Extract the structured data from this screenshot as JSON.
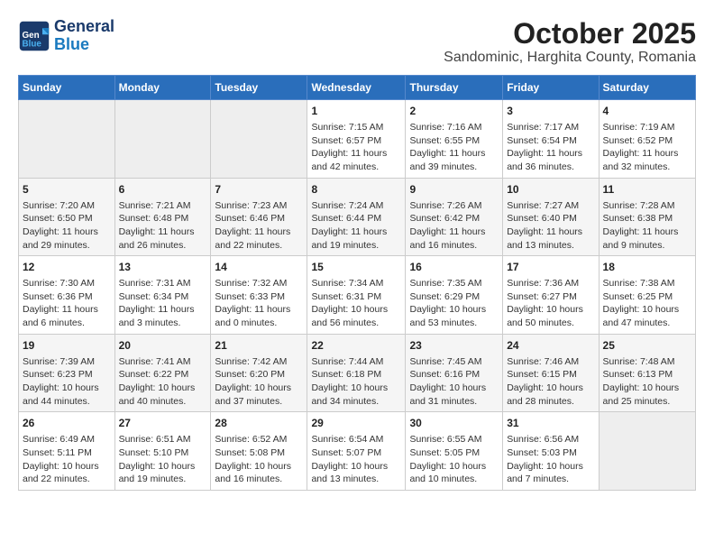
{
  "logo": {
    "line1": "General",
    "line2": "Blue"
  },
  "title": "October 2025",
  "subtitle": "Sandominic, Harghita County, Romania",
  "weekdays": [
    "Sunday",
    "Monday",
    "Tuesday",
    "Wednesday",
    "Thursday",
    "Friday",
    "Saturday"
  ],
  "weeks": [
    [
      {
        "day": "",
        "empty": true
      },
      {
        "day": "",
        "empty": true
      },
      {
        "day": "",
        "empty": true
      },
      {
        "day": "1",
        "sunrise": "7:15 AM",
        "sunset": "6:57 PM",
        "daylight": "11 hours and 42 minutes."
      },
      {
        "day": "2",
        "sunrise": "7:16 AM",
        "sunset": "6:55 PM",
        "daylight": "11 hours and 39 minutes."
      },
      {
        "day": "3",
        "sunrise": "7:17 AM",
        "sunset": "6:54 PM",
        "daylight": "11 hours and 36 minutes."
      },
      {
        "day": "4",
        "sunrise": "7:19 AM",
        "sunset": "6:52 PM",
        "daylight": "11 hours and 32 minutes."
      }
    ],
    [
      {
        "day": "5",
        "sunrise": "7:20 AM",
        "sunset": "6:50 PM",
        "daylight": "11 hours and 29 minutes."
      },
      {
        "day": "6",
        "sunrise": "7:21 AM",
        "sunset": "6:48 PM",
        "daylight": "11 hours and 26 minutes."
      },
      {
        "day": "7",
        "sunrise": "7:23 AM",
        "sunset": "6:46 PM",
        "daylight": "11 hours and 22 minutes."
      },
      {
        "day": "8",
        "sunrise": "7:24 AM",
        "sunset": "6:44 PM",
        "daylight": "11 hours and 19 minutes."
      },
      {
        "day": "9",
        "sunrise": "7:26 AM",
        "sunset": "6:42 PM",
        "daylight": "11 hours and 16 minutes."
      },
      {
        "day": "10",
        "sunrise": "7:27 AM",
        "sunset": "6:40 PM",
        "daylight": "11 hours and 13 minutes."
      },
      {
        "day": "11",
        "sunrise": "7:28 AM",
        "sunset": "6:38 PM",
        "daylight": "11 hours and 9 minutes."
      }
    ],
    [
      {
        "day": "12",
        "sunrise": "7:30 AM",
        "sunset": "6:36 PM",
        "daylight": "11 hours and 6 minutes."
      },
      {
        "day": "13",
        "sunrise": "7:31 AM",
        "sunset": "6:34 PM",
        "daylight": "11 hours and 3 minutes."
      },
      {
        "day": "14",
        "sunrise": "7:32 AM",
        "sunset": "6:33 PM",
        "daylight": "11 hours and 0 minutes."
      },
      {
        "day": "15",
        "sunrise": "7:34 AM",
        "sunset": "6:31 PM",
        "daylight": "10 hours and 56 minutes."
      },
      {
        "day": "16",
        "sunrise": "7:35 AM",
        "sunset": "6:29 PM",
        "daylight": "10 hours and 53 minutes."
      },
      {
        "day": "17",
        "sunrise": "7:36 AM",
        "sunset": "6:27 PM",
        "daylight": "10 hours and 50 minutes."
      },
      {
        "day": "18",
        "sunrise": "7:38 AM",
        "sunset": "6:25 PM",
        "daylight": "10 hours and 47 minutes."
      }
    ],
    [
      {
        "day": "19",
        "sunrise": "7:39 AM",
        "sunset": "6:23 PM",
        "daylight": "10 hours and 44 minutes."
      },
      {
        "day": "20",
        "sunrise": "7:41 AM",
        "sunset": "6:22 PM",
        "daylight": "10 hours and 40 minutes."
      },
      {
        "day": "21",
        "sunrise": "7:42 AM",
        "sunset": "6:20 PM",
        "daylight": "10 hours and 37 minutes."
      },
      {
        "day": "22",
        "sunrise": "7:44 AM",
        "sunset": "6:18 PM",
        "daylight": "10 hours and 34 minutes."
      },
      {
        "day": "23",
        "sunrise": "7:45 AM",
        "sunset": "6:16 PM",
        "daylight": "10 hours and 31 minutes."
      },
      {
        "day": "24",
        "sunrise": "7:46 AM",
        "sunset": "6:15 PM",
        "daylight": "10 hours and 28 minutes."
      },
      {
        "day": "25",
        "sunrise": "7:48 AM",
        "sunset": "6:13 PM",
        "daylight": "10 hours and 25 minutes."
      }
    ],
    [
      {
        "day": "26",
        "sunrise": "6:49 AM",
        "sunset": "5:11 PM",
        "daylight": "10 hours and 22 minutes."
      },
      {
        "day": "27",
        "sunrise": "6:51 AM",
        "sunset": "5:10 PM",
        "daylight": "10 hours and 19 minutes."
      },
      {
        "day": "28",
        "sunrise": "6:52 AM",
        "sunset": "5:08 PM",
        "daylight": "10 hours and 16 minutes."
      },
      {
        "day": "29",
        "sunrise": "6:54 AM",
        "sunset": "5:07 PM",
        "daylight": "10 hours and 13 minutes."
      },
      {
        "day": "30",
        "sunrise": "6:55 AM",
        "sunset": "5:05 PM",
        "daylight": "10 hours and 10 minutes."
      },
      {
        "day": "31",
        "sunrise": "6:56 AM",
        "sunset": "5:03 PM",
        "daylight": "10 hours and 7 minutes."
      },
      {
        "day": "",
        "empty": true
      }
    ]
  ]
}
